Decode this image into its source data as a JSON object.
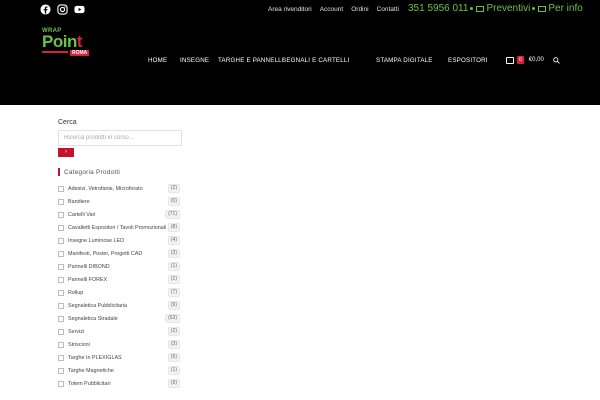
{
  "topbar": {
    "social_icons": [
      "facebook-icon",
      "instagram-icon",
      "youtube-icon"
    ],
    "links": [
      "Area rivenditori",
      "Account",
      "Ordini",
      "Contatti"
    ],
    "phone": "351 5956 011",
    "preventivi": "Preventivi",
    "per_info": "Per info"
  },
  "header": {
    "logo": {
      "line1": "WRAP",
      "line2a": "Poin",
      "line2b": "t",
      "line3": "ROMA"
    },
    "nav": [
      "HOME",
      "INSEGNE",
      "TARGHE E PANNELLI",
      "SEGNALI E CARTELLI",
      "STAMPA DIGITALE",
      "ESPOSITORI"
    ],
    "cart_count": "0",
    "cart_total": "€0,00"
  },
  "sidebar": {
    "search_label": "Cerca",
    "search_placeholder": "Ricerca prodotti in corso...",
    "search_button": "›",
    "category_title": "Categoria Prodotti",
    "categories": [
      {
        "label": "Adesivi, Vetrofanie, Microforato",
        "count": "(2)"
      },
      {
        "label": "Bandiere",
        "count": "(0)"
      },
      {
        "label": "Cartelli Vari",
        "count": "(71)"
      },
      {
        "label": "Cavalletti Espositori / Tavoli Promozionali",
        "count": "(8)"
      },
      {
        "label": "Insegne Luminose LED",
        "count": "(4)"
      },
      {
        "label": "Manifesti, Poster, Progetti CAD",
        "count": "(3)"
      },
      {
        "label": "Pannelli DIBOND",
        "count": "(1)"
      },
      {
        "label": "Pannelli FOREX",
        "count": "(1)"
      },
      {
        "label": "Rollup",
        "count": "(7)"
      },
      {
        "label": "Segnaletica Pubblicitaria",
        "count": "(9)"
      },
      {
        "label": "Segnaletica Stradale",
        "count": "(63)"
      },
      {
        "label": "Servizi",
        "count": "(2)"
      },
      {
        "label": "Striscioni",
        "count": "(3)"
      },
      {
        "label": "Targhe In PLEXIGLAS",
        "count": "(5)"
      },
      {
        "label": "Targhe Magnetiche",
        "count": "(1)"
      },
      {
        "label": "Totem Pubblicitari",
        "count": "(9)"
      }
    ]
  },
  "colors": {
    "accent": "#c8102e",
    "green": "#6cc04a",
    "header_bg": "#000000"
  }
}
